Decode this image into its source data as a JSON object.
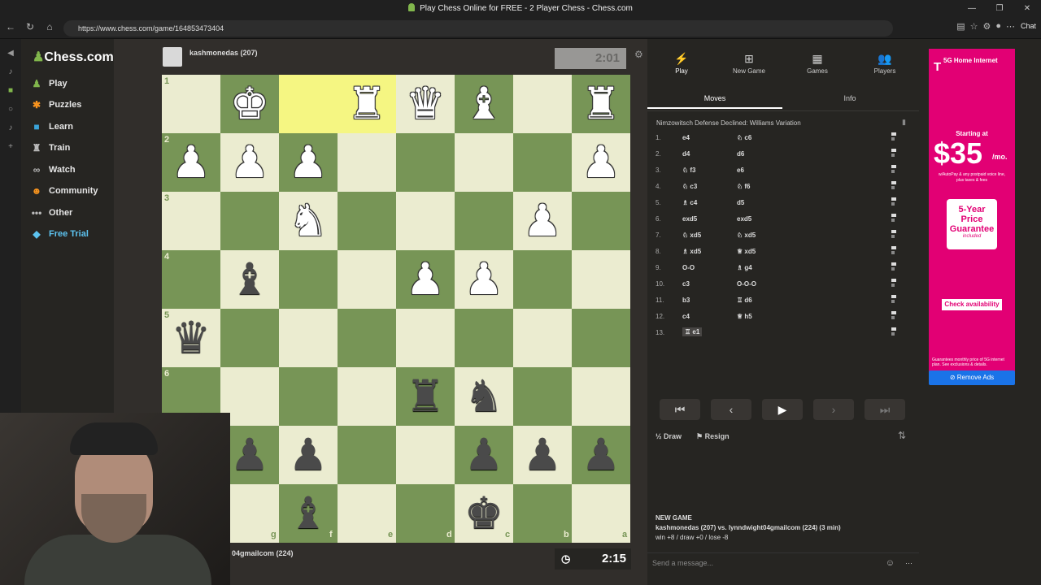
{
  "window": {
    "title": "Play Chess Online for FREE - 2 Player Chess - Chess.com",
    "url": "https://www.chess.com/game/164853473404"
  },
  "browser": {
    "copilot_label": "Chat"
  },
  "sidebar": {
    "logo": "Chess.com",
    "items": [
      {
        "label": "Play",
        "icon": "play-pawn-icon"
      },
      {
        "label": "Puzzles",
        "icon": "puzzle-icon"
      },
      {
        "label": "Learn",
        "icon": "learn-icon"
      },
      {
        "label": "Train",
        "icon": "train-icon"
      },
      {
        "label": "Watch",
        "icon": "binoculars-icon"
      },
      {
        "label": "Community",
        "icon": "community-icon"
      },
      {
        "label": "Other",
        "icon": "ellipsis-icon"
      },
      {
        "label": "Free Trial",
        "icon": "diamond-icon"
      }
    ]
  },
  "top_player": {
    "name": "kashmonedas (207)",
    "clock": "2:01"
  },
  "bottom_player": {
    "name": "04gmailcom (224)",
    "clock": "2:15"
  },
  "board": {
    "light_color": "#ebecd0",
    "dark_color": "#779556",
    "highlight_color": "#f5f682",
    "ranks": [
      "1",
      "2",
      "3",
      "4",
      "5",
      "6"
    ],
    "files": [
      "g",
      "f",
      "e",
      "d",
      "c",
      "b",
      "a"
    ],
    "pieces": [
      {
        "glyph": "♚",
        "side": "w",
        "row": 0,
        "col": 1
      },
      {
        "glyph": "♜",
        "side": "w",
        "row": 0,
        "col": 3
      },
      {
        "glyph": "♛",
        "side": "w",
        "row": 0,
        "col": 4
      },
      {
        "glyph": "♝",
        "side": "w",
        "row": 0,
        "col": 5
      },
      {
        "glyph": "♜",
        "side": "w",
        "row": 0,
        "col": 7
      },
      {
        "glyph": "♟",
        "side": "w",
        "row": 1,
        "col": 0
      },
      {
        "glyph": "♟",
        "side": "w",
        "row": 1,
        "col": 1
      },
      {
        "glyph": "♟",
        "side": "w",
        "row": 1,
        "col": 2
      },
      {
        "glyph": "♟",
        "side": "w",
        "row": 1,
        "col": 7
      },
      {
        "glyph": "♞",
        "side": "w",
        "row": 2,
        "col": 2
      },
      {
        "glyph": "♟",
        "side": "w",
        "row": 2,
        "col": 6
      },
      {
        "glyph": "♝",
        "side": "b",
        "row": 3,
        "col": 1
      },
      {
        "glyph": "♟",
        "side": "w",
        "row": 3,
        "col": 4
      },
      {
        "glyph": "♟",
        "side": "w",
        "row": 3,
        "col": 5
      },
      {
        "glyph": "♛",
        "side": "b",
        "row": 4,
        "col": 0
      },
      {
        "glyph": "♜",
        "side": "b",
        "row": 5,
        "col": 4
      },
      {
        "glyph": "♞",
        "side": "b",
        "row": 5,
        "col": 5
      },
      {
        "glyph": "♟",
        "side": "b",
        "row": 6,
        "col": 1
      },
      {
        "glyph": "♟",
        "side": "b",
        "row": 6,
        "col": 2
      },
      {
        "glyph": "♟",
        "side": "b",
        "row": 6,
        "col": 5
      },
      {
        "glyph": "♟",
        "side": "b",
        "row": 6,
        "col": 6
      },
      {
        "glyph": "♟",
        "side": "b",
        "row": 6,
        "col": 7
      },
      {
        "glyph": "♝",
        "side": "b",
        "row": 7,
        "col": 2
      },
      {
        "glyph": "♚",
        "side": "b",
        "row": 7,
        "col": 5
      }
    ],
    "highlighted": [
      {
        "row": 0,
        "col": 2
      },
      {
        "row": 0,
        "col": 3
      }
    ]
  },
  "panel": {
    "tabs": [
      "Play",
      "New Game",
      "Games",
      "Players"
    ],
    "subtabs": [
      "Moves",
      "Info"
    ],
    "opening": "Nimzowitsch Defense Declined: Williams Variation",
    "moves": [
      {
        "n": "1.",
        "w": "e4",
        "b": "♘ c6"
      },
      {
        "n": "2.",
        "w": "d4",
        "b": "d6"
      },
      {
        "n": "3.",
        "w": "♘ f3",
        "b": "e6"
      },
      {
        "n": "4.",
        "w": "♘ c3",
        "b": "♘ f6"
      },
      {
        "n": "5.",
        "w": "♗ c4",
        "b": "d5"
      },
      {
        "n": "6.",
        "w": "exd5",
        "b": "exd5"
      },
      {
        "n": "7.",
        "w": "♘ xd5",
        "b": "♘ xd5"
      },
      {
        "n": "8.",
        "w": "♗ xd5",
        "b": "♕ xd5"
      },
      {
        "n": "9.",
        "w": "O-O",
        "b": "♗ g4"
      },
      {
        "n": "10.",
        "w": "c3",
        "b": "O-O-O"
      },
      {
        "n": "11.",
        "w": "b3",
        "b": "♖ d6"
      },
      {
        "n": "12.",
        "w": "c4",
        "b": "♕ h5"
      },
      {
        "n": "13.",
        "w": "♖ e1",
        "b": ""
      }
    ],
    "draw": "Draw",
    "resign": "Resign",
    "new_game_header": "NEW GAME",
    "new_game_line1": "kashmonedas (207) vs. lynndwight04gmailcom (224) (3 min)",
    "new_game_line2": "win +8 / draw +0 / lose -8",
    "message_placeholder": "Send a message..."
  },
  "ad": {
    "brand": "5G Home Internet",
    "starting": "Starting at",
    "price": "$35",
    "per": "/mo.",
    "fine": "w/AutoPay & any postpaid voice line, plus taxes & fees",
    "guarantee": "5-Year Price Guarantee",
    "guarantee_sub": "included",
    "cta": "Check availability",
    "disclaimer": "Guarantees monthly price of 5G internet plan. See exclusions & details.",
    "remove": "Remove Ads",
    "brand_color": "#e20074"
  }
}
